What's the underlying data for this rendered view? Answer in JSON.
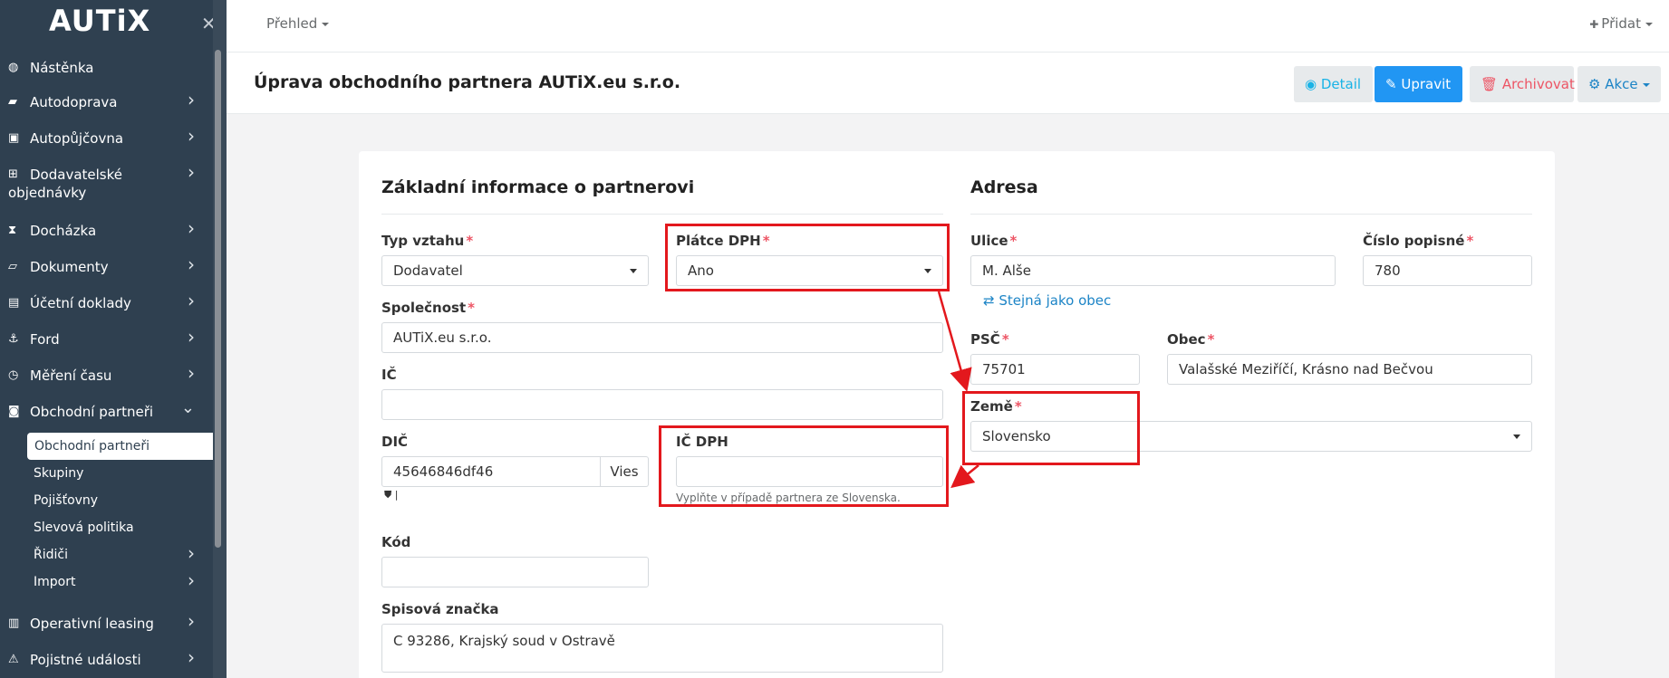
{
  "sidebar": {
    "logo": "AUTiX",
    "close_glyph": "✕",
    "items": [
      {
        "label": "Nástěnka",
        "icon": "dashboard-icon",
        "glyph": "◍",
        "chevron": false
      },
      {
        "label": "Autodoprava",
        "icon": "truck-icon",
        "glyph": "▰",
        "chevron": true
      },
      {
        "label": "Autopůjčovna",
        "icon": "car-icon",
        "glyph": "▣",
        "chevron": true
      },
      {
        "label": "Dodavatelské",
        "label2": "objednávky",
        "icon": "cart-icon",
        "glyph": "⊞",
        "chevron": true
      },
      {
        "label": "Docházka",
        "icon": "hourglass-icon",
        "glyph": "⧗",
        "chevron": true
      },
      {
        "label": "Dokumenty",
        "icon": "folder-icon",
        "glyph": "▱",
        "chevron": true
      },
      {
        "label": "Účetní doklady",
        "icon": "document-icon",
        "glyph": "▤",
        "chevron": true
      },
      {
        "label": "Ford",
        "icon": "anchor-icon",
        "glyph": "⚓",
        "chevron": true
      },
      {
        "label": "Měření času",
        "icon": "clock-icon",
        "glyph": "◷",
        "chevron": true
      },
      {
        "label": "Obchodní partneři",
        "icon": "bag-icon",
        "glyph": "◙",
        "chevron": true
      }
    ],
    "subitems": [
      {
        "label": "Obchodní partneři",
        "active": true
      },
      {
        "label": "Skupiny"
      },
      {
        "label": "Pojišťovny"
      },
      {
        "label": "Slevová politika"
      },
      {
        "label": "Řidiči",
        "chevron": true
      },
      {
        "label": "Import",
        "chevron": true
      }
    ],
    "items_after": [
      {
        "label": "Operativní leasing",
        "icon": "book-icon",
        "glyph": "▥",
        "chevron": true
      },
      {
        "label": "Pojistné události",
        "icon": "warning-icon",
        "glyph": "⚠",
        "chevron": true
      }
    ]
  },
  "topbar": {
    "overview": "Přehled",
    "add": "Přidat",
    "add_glyph": "✚"
  },
  "header": {
    "title": "Úprava obchodního partnera AUTiX.eu s.r.o.",
    "detail": "Detail",
    "edit": "Upravit",
    "archive": "Archivovat",
    "actions": "Akce"
  },
  "form": {
    "basic_title": "Základní informace o partnerovi",
    "relation_type": {
      "label": "Typ vztahu",
      "value": "Dodavatel"
    },
    "vat_payer": {
      "label": "Plátce DPH",
      "value": "Ano"
    },
    "company": {
      "label": "Společnost",
      "value": "AUTiX.eu s.r.o."
    },
    "ic": {
      "label": "IČ",
      "value": ""
    },
    "dic": {
      "label": "DIČ",
      "value": "45646846df46",
      "addon": "Vies",
      "status_icons": "⛊ |"
    },
    "ic_dph": {
      "label": "IČ DPH",
      "value": "",
      "hint": "Vyplňte v případě partnera ze Slovenska."
    },
    "code": {
      "label": "Kód",
      "value": ""
    },
    "file_no": {
      "label": "Spisová značka",
      "value": "C 93286, Krajský soud v Ostravě"
    }
  },
  "address": {
    "title": "Adresa",
    "street": {
      "label": "Ulice",
      "value": "M. Alše"
    },
    "number": {
      "label": "Číslo popisné",
      "value": "780"
    },
    "same_as_city": "Stejná jako obec",
    "psc": {
      "label": "PSČ",
      "value": "75701"
    },
    "city": {
      "label": "Obec",
      "value": "Valašské Meziříčí, Krásno nad Bečvou"
    },
    "country": {
      "label": "Země",
      "value": "Slovensko"
    }
  },
  "colors": {
    "sidebar": "#2f4050",
    "primary": "#2196f3",
    "danger": "#ed5565",
    "annotation": "#e3181d"
  }
}
